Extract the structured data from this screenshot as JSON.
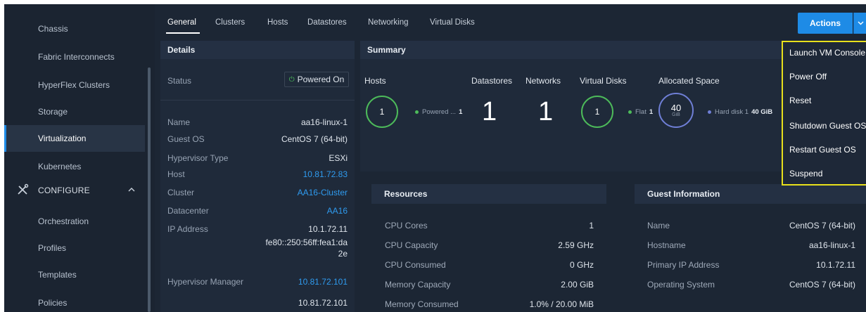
{
  "sidebar": {
    "items": [
      {
        "label": "Chassis"
      },
      {
        "label": "Fabric Interconnects"
      },
      {
        "label": "HyperFlex Clusters"
      },
      {
        "label": "Storage"
      },
      {
        "label": "Virtualization"
      },
      {
        "label": "Kubernetes"
      }
    ],
    "section": {
      "label": "CONFIGURE",
      "icon": "wrench-screwdriver-icon"
    },
    "section_items": [
      {
        "label": "Orchestration"
      },
      {
        "label": "Profiles"
      },
      {
        "label": "Templates"
      },
      {
        "label": "Policies"
      }
    ]
  },
  "tabs": [
    {
      "label": "General"
    },
    {
      "label": "Clusters"
    },
    {
      "label": "Hosts"
    },
    {
      "label": "Datastores"
    },
    {
      "label": "Networking"
    },
    {
      "label": "Virtual Disks"
    }
  ],
  "actions": {
    "label": "Actions",
    "menu": [
      {
        "label": "Launch VM Console"
      },
      {
        "label": "Power Off"
      },
      {
        "label": "Reset"
      },
      {
        "label": "Shutdown Guest OS"
      },
      {
        "label": "Restart Guest OS"
      },
      {
        "label": "Suspend"
      }
    ]
  },
  "details": {
    "title": "Details",
    "status_label": "Status",
    "status_value": "Powered On",
    "rows": [
      {
        "label": "Name",
        "value": "aa16-linux-1"
      },
      {
        "label": "Guest OS",
        "value": "CentOS 7 (64-bit)"
      },
      {
        "label": "Hypervisor Type",
        "value": "ESXi"
      },
      {
        "label": "Host",
        "value": "10.81.72.83"
      },
      {
        "label": "Cluster",
        "value": "AA16-Cluster"
      },
      {
        "label": "Datacenter",
        "value": "AA16"
      },
      {
        "label": "IP Address",
        "value": "10.1.72.11"
      }
    ],
    "ipv6_line1": "fe80::250:56ff:fea1:da",
    "ipv6_line2": "2e",
    "hypervisor_manager_label": "Hypervisor Manager",
    "hypervisor_manager_value": "10.81.72.101",
    "extra_value": "10.81.72.101"
  },
  "summary": {
    "title": "Summary",
    "hosts": {
      "label": "Hosts",
      "count": "1",
      "legend": "Powered ...",
      "legend_value": "1"
    },
    "datastores": {
      "label": "Datastores",
      "count": "1"
    },
    "networks": {
      "label": "Networks",
      "count": "1"
    },
    "virtual_disks": {
      "label": "Virtual Disks",
      "count": "1",
      "legend": "Flat",
      "legend_value": "1"
    },
    "allocated_space": {
      "label": "Allocated Space",
      "value": "40",
      "unit": "GiB",
      "legend": "Hard disk 1",
      "legend_value": "40 GiB"
    }
  },
  "resources": {
    "title": "Resources",
    "rows": [
      {
        "label": "CPU Cores",
        "value": "1"
      },
      {
        "label": "CPU Capacity",
        "value": "2.59 GHz"
      },
      {
        "label": "CPU Consumed",
        "value": "0 GHz"
      },
      {
        "label": "Memory Capacity",
        "value": "2.00 GiB"
      },
      {
        "label": "Memory Consumed",
        "value": "1.0% / 20.00 MiB"
      }
    ]
  },
  "guest": {
    "title": "Guest Information",
    "rows": [
      {
        "label": "Name",
        "value": "CentOS 7 (64-bit)"
      },
      {
        "label": "Hostname",
        "value": "aa16-linux-1"
      },
      {
        "label": "Primary IP Address",
        "value": "10.1.72.11"
      },
      {
        "label": "Operating System",
        "value": "CentOS 7 (64-bit)"
      }
    ]
  },
  "colors": {
    "accent": "#1e8be6",
    "link": "#2f9bef",
    "status_green": "#4dbb5a",
    "disk_purple": "#6f7fd6",
    "highlight_yellow": "#e8e01c"
  }
}
